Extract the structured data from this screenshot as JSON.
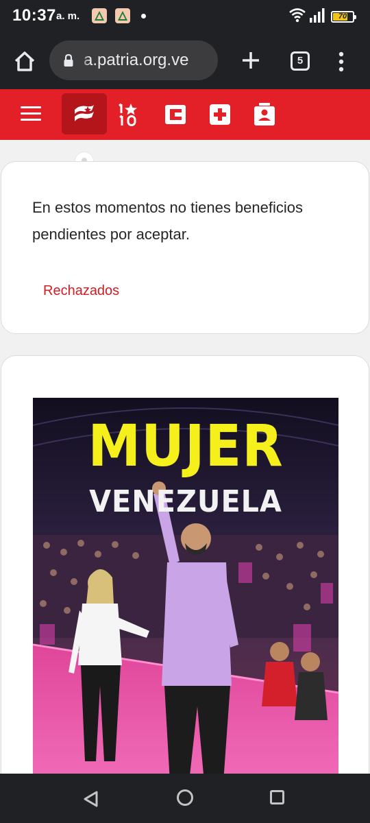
{
  "status_bar": {
    "time": "10:37",
    "ampm": "a. m.",
    "notification_icons": [
      "leaf-notification-icon",
      "leaf-notification-icon"
    ],
    "battery_level": "70",
    "battery_fraction": 0.7,
    "battery_color": "#f0c419"
  },
  "browser": {
    "url": "a.patria.org.ve",
    "tab_count": "5",
    "icons": [
      "home-icon",
      "lock-icon",
      "plus-icon",
      "tabs-icon",
      "more-vert-icon"
    ]
  },
  "app_nav": {
    "brand_color": "#e32027",
    "active_color": "#b3151b",
    "items": [
      "menu-icon",
      "patria-logo-icon",
      "1x10-icon",
      "wallet-icon",
      "health-cross-icon",
      "profile-card-icon"
    ]
  },
  "card_pending": {
    "message": "En estos momentos no tienes beneficios pendientes por aceptar.",
    "rejected_link": "Rechazados",
    "link_color": "#d01c23"
  },
  "banner": {
    "title": "MUJER",
    "subtitle": "VENEZUELA",
    "title_color": "#f5f01c"
  },
  "android_nav": {
    "icons": [
      "back-icon",
      "home-circle-icon",
      "recents-icon"
    ]
  }
}
